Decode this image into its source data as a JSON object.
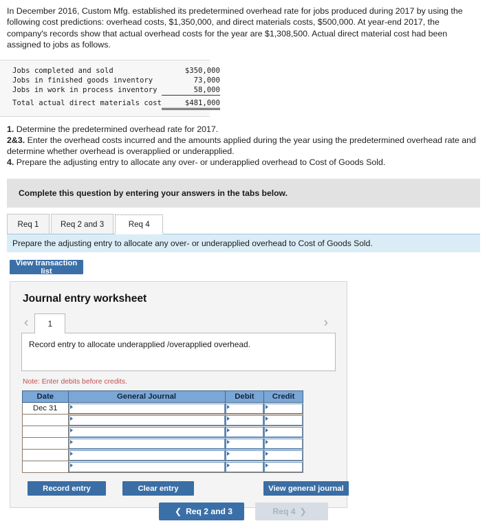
{
  "problem": {
    "paragraph": "In December 2016, Custom Mfg. established its predetermined overhead rate for jobs produced during 2017 by using the following cost predictions: overhead costs, $1,350,000, and direct materials costs, $500,000. At year-end 2017, the company's records show that actual overhead costs for the year are $1,308,500. Actual direct material cost had been assigned to jobs as follows."
  },
  "facts_table": {
    "rows": [
      {
        "label": "Jobs completed and sold",
        "amount": "$350,000"
      },
      {
        "label": "Jobs in finished goods inventory",
        "amount": "73,000"
      },
      {
        "label": "Jobs in work in process inventory",
        "amount": "58,000"
      }
    ],
    "total": {
      "label": "Total actual direct materials cost",
      "amount": "$481,000"
    }
  },
  "requirements": [
    {
      "num": "1.",
      "text": " Determine the predetermined overhead rate for 2017."
    },
    {
      "num": "2&3.",
      "text": " Enter the overhead costs incurred and the amounts applied during the year using the predetermined overhead rate and determine whether overhead is overapplied or underapplied."
    },
    {
      "num": "4.",
      "text": " Prepare the adjusting entry to allocate any over- or underapplied overhead to Cost of Goods Sold."
    }
  ],
  "banner": {
    "text": "Complete this question by entering your answers in the tabs below."
  },
  "tabs": [
    {
      "label": "Req 1",
      "active": false
    },
    {
      "label": "Req 2 and 3",
      "active": false
    },
    {
      "label": "Req 4",
      "active": true
    }
  ],
  "subinstruction": {
    "text": "Prepare the adjusting entry to allocate any over- or underapplied overhead to Cost of Goods Sold."
  },
  "buttons": {
    "view_transaction_list": "View transaction list",
    "record_entry": "Record entry",
    "clear_entry": "Clear entry",
    "view_general_journal": "View general journal"
  },
  "worksheet": {
    "title": "Journal entry worksheet",
    "page_tab": "1",
    "prev_icon": "chevron-left-icon",
    "next_icon": "chevron-right-icon",
    "entry_prompt": "Record entry to allocate underapplied /overapplied overhead.",
    "note": "Note: Enter debits before credits."
  },
  "journal": {
    "headers": [
      "Date",
      "General Journal",
      "Debit",
      "Credit"
    ],
    "rows": [
      {
        "date": "Dec 31",
        "general_journal": "",
        "debit": "",
        "credit": ""
      },
      {
        "date": "",
        "general_journal": "",
        "debit": "",
        "credit": ""
      },
      {
        "date": "",
        "general_journal": "",
        "debit": "",
        "credit": ""
      },
      {
        "date": "",
        "general_journal": "",
        "debit": "",
        "credit": ""
      },
      {
        "date": "",
        "general_journal": "",
        "debit": "",
        "credit": ""
      },
      {
        "date": "",
        "general_journal": "",
        "debit": "",
        "credit": ""
      }
    ]
  },
  "footer_nav": {
    "prev_label": "Req 2 and 3",
    "prev_icon": "chevron-left-icon",
    "next_label": "Req 4",
    "next_icon": "chevron-right-icon"
  },
  "colors": {
    "accent_blue": "#3b6fa8",
    "table_header_blue": "#7ba7d7",
    "instruction_blue": "#daedf7",
    "banner_gray": "#e2e2e2",
    "note_red": "#c0504d"
  }
}
